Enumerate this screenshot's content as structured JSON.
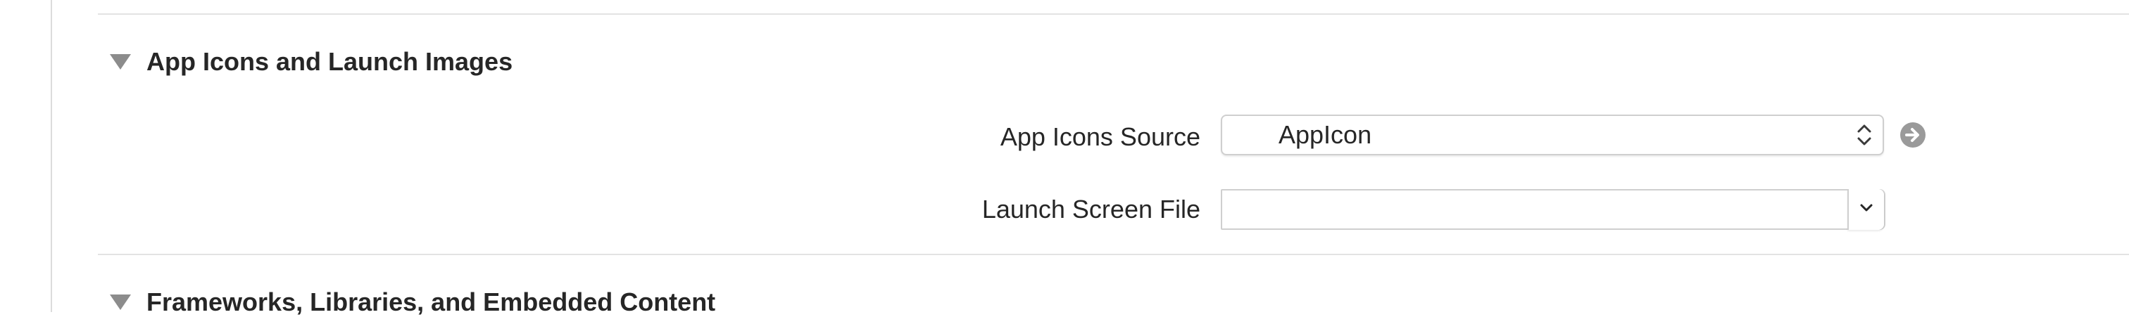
{
  "sections": [
    {
      "title": "App Icons and Launch Images",
      "expanded": true,
      "disclosure_icon": "disclosure-triangle-down"
    },
    {
      "title": "Frameworks, Libraries, and Embedded Content",
      "expanded": true,
      "disclosure_icon": "disclosure-triangle-down"
    }
  ],
  "app_icons": {
    "source_label": "App Icons Source",
    "source_value": "AppIcon",
    "source_icons": [
      "up-down-chevron-icon",
      "go-to-arrow-icon"
    ],
    "launch_label": "Launch Screen File",
    "launch_value": "",
    "launch_icons": [
      "chevron-down-icon"
    ]
  },
  "colors": {
    "text": "#262626",
    "disclosure": "#8c8c8c",
    "separator": "#e3e3e3",
    "control_border": "#cfcfcf",
    "arrow_button": "#9a9a9a"
  }
}
